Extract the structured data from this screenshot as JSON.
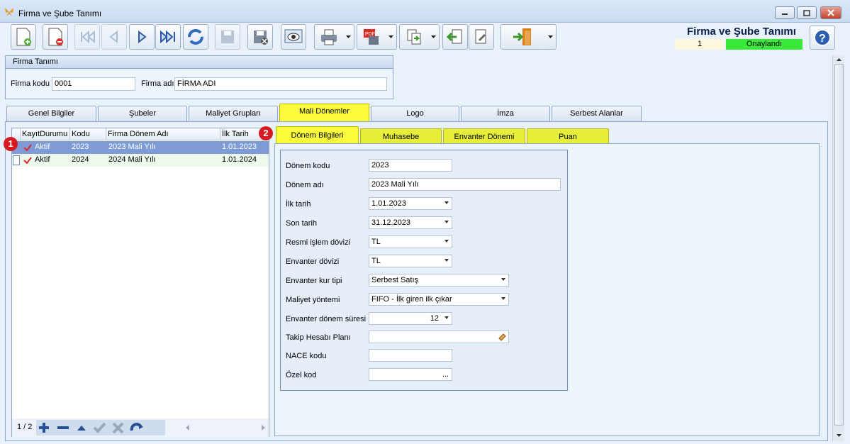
{
  "window": {
    "title": "Firma ve Şube Tanımı"
  },
  "header": {
    "form_title": "Firma ve Şube Tanımı",
    "record_no": "1",
    "status": "Onaylandı"
  },
  "firma": {
    "group_title": "Firma Tanımı",
    "kod_label": "Firma kodu",
    "kod_value": "0001",
    "adi_label": "Firma adı",
    "adi_value": "FİRMA ADI"
  },
  "tabs": [
    "Genel Bilgiler",
    "Şubeler",
    "Maliyet Grupları",
    "Mali Dönemler",
    "Logo",
    "İmza",
    "Serbest Alanlar"
  ],
  "grid": {
    "columns": [
      "KayıtDurumu",
      "Kodu",
      "Firma Dönem Adı",
      "İlk Tarih"
    ],
    "rows": [
      [
        "Aktif",
        "2023",
        "2023 Mali Yılı",
        "1.01.2023"
      ],
      [
        "Aktif",
        "2024",
        "2024 Mali Yılı",
        "1.01.2024"
      ]
    ],
    "pager": "1 / 2"
  },
  "subtabs": [
    "Dönem Bilgileri",
    "Muhasebe",
    "Envanter Dönemi",
    "Puan"
  ],
  "badges": [
    "1",
    "2"
  ],
  "form": {
    "donem_kodu": {
      "label": "Dönem kodu",
      "value": "2023"
    },
    "donem_adi": {
      "label": "Dönem adı",
      "value": "2023 Mali Yılı"
    },
    "ilk_tarih": {
      "label": "İlk tarih",
      "value": "1.01.2023"
    },
    "son_tarih": {
      "label": "Son tarih",
      "value": "31.12.2023"
    },
    "resmi_doviz": {
      "label": "Resmi işlem dövizi",
      "value": "TL"
    },
    "envanter_doviz": {
      "label": "Envanter dövizi",
      "value": "TL"
    },
    "kur_tipi": {
      "label": "Envanter kur tipi",
      "value": "Serbest Satış"
    },
    "maliyet": {
      "label": "Maliyet yöntemi",
      "value": "FIFO - İlk giren ilk çıkar"
    },
    "donem_suresi": {
      "label": "Envanter dönem süresi",
      "value": "12"
    },
    "takip": {
      "label": "Takip Hesabı Planı",
      "value": ""
    },
    "nace": {
      "label": "NACE kodu",
      "value": ""
    },
    "ozel": {
      "label": "Özel kod",
      "value": "..."
    }
  }
}
